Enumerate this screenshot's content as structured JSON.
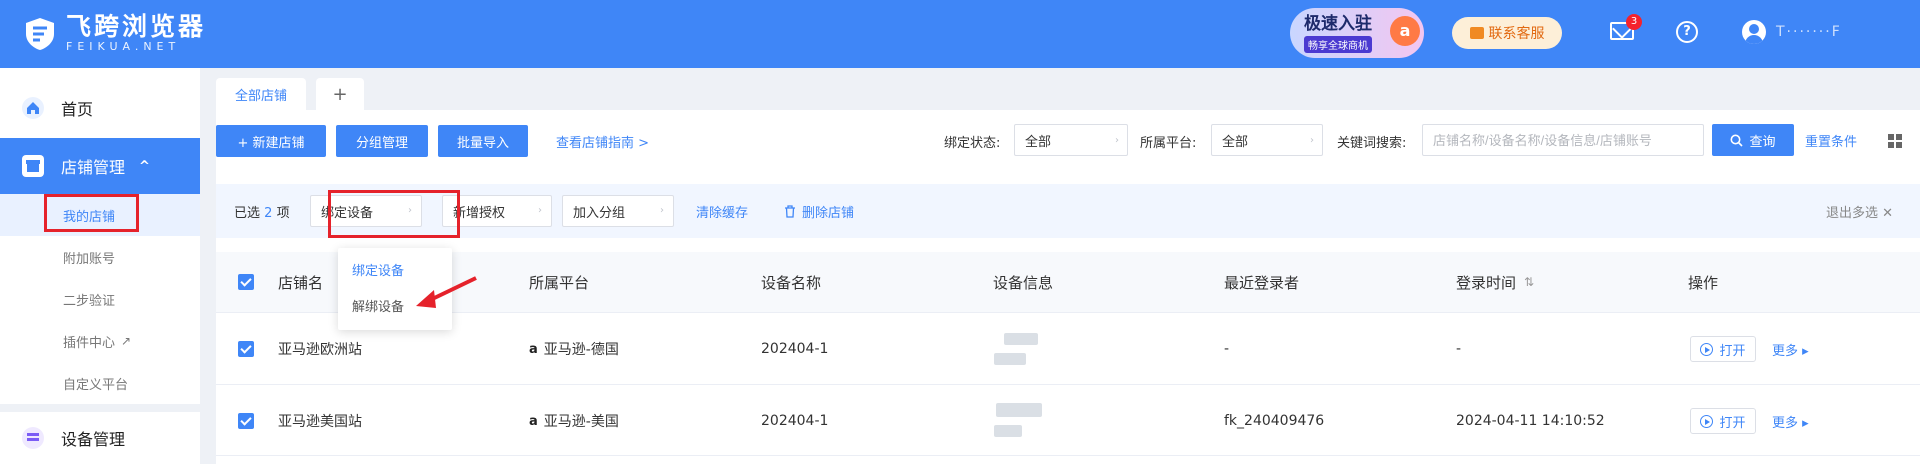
{
  "header": {
    "logo_cn": "飞跨浏览器",
    "logo_en": "FEIKUA.NET",
    "promo_title": "极速入驻",
    "promo_sub": "畅享全球商机",
    "promo_badge": "a",
    "service_label": "联系客服",
    "mail_count": "3",
    "help_label": "?",
    "username": "T·······F"
  },
  "sidebar": {
    "home": "首页",
    "store_mgmt": "店铺管理",
    "store_chevron": "^",
    "sub": [
      "我的店铺",
      "附加账号",
      "二步验证",
      "插件中心",
      "自定义平台"
    ],
    "plugin_ext": "↗",
    "device_mgmt": "设备管理"
  },
  "tabs": {
    "all_stores": "全部店铺",
    "add": "+"
  },
  "toolbar": {
    "new_store": "+ 新建店铺",
    "group_mgmt": "分组管理",
    "batch_import": "批量导入",
    "guide_link": "查看店铺指南 >",
    "bind_status_label": "绑定状态:",
    "bind_status_value": "全部",
    "platform_label": "所属平台:",
    "platform_value": "全部",
    "keyword_label": "关键词搜索:",
    "keyword_placeholder": "店铺名称/设备名称/设备信息/店铺账号",
    "query": "查询",
    "reset": "重置条件"
  },
  "selection_bar": {
    "selected_prefix": "已选",
    "selected_count": "2",
    "selected_suffix": "项",
    "bind_device": "绑定设备",
    "add_auth": "新增授权",
    "add_group": "加入分组",
    "clear_cache": "清除缓存",
    "delete_store": "删除店铺",
    "exit_multi": "退出多选"
  },
  "dropdown": {
    "items": [
      "绑定设备",
      "解绑设备"
    ]
  },
  "table": {
    "headers": {
      "store": "店铺名",
      "platform": "所属平台",
      "device_name": "设备名称",
      "device_info": "设备信息",
      "last_login_user": "最近登录者",
      "login_time": "登录时间",
      "actions": "操作"
    },
    "sort_icon": "⇅",
    "rows": [
      {
        "store": "亚马逊欧洲站",
        "platform_logo": "a",
        "platform": "亚马逊-德国",
        "device_name": "202404-1",
        "last_user": "-",
        "login_time": "-",
        "open": "打开",
        "more": "更多 ▸"
      },
      {
        "store": "亚马逊美国站",
        "platform_logo": "a",
        "platform": "亚马逊-美国",
        "device_name": "202404-1",
        "last_user": "fk_240409476",
        "login_time": "2024-04-11 14:10:52",
        "open": "打开",
        "more": "更多 ▸"
      }
    ]
  },
  "colors": {
    "primary": "#3f86f7",
    "highlight_border": "#e5222b",
    "arrow": "#e5222b"
  }
}
